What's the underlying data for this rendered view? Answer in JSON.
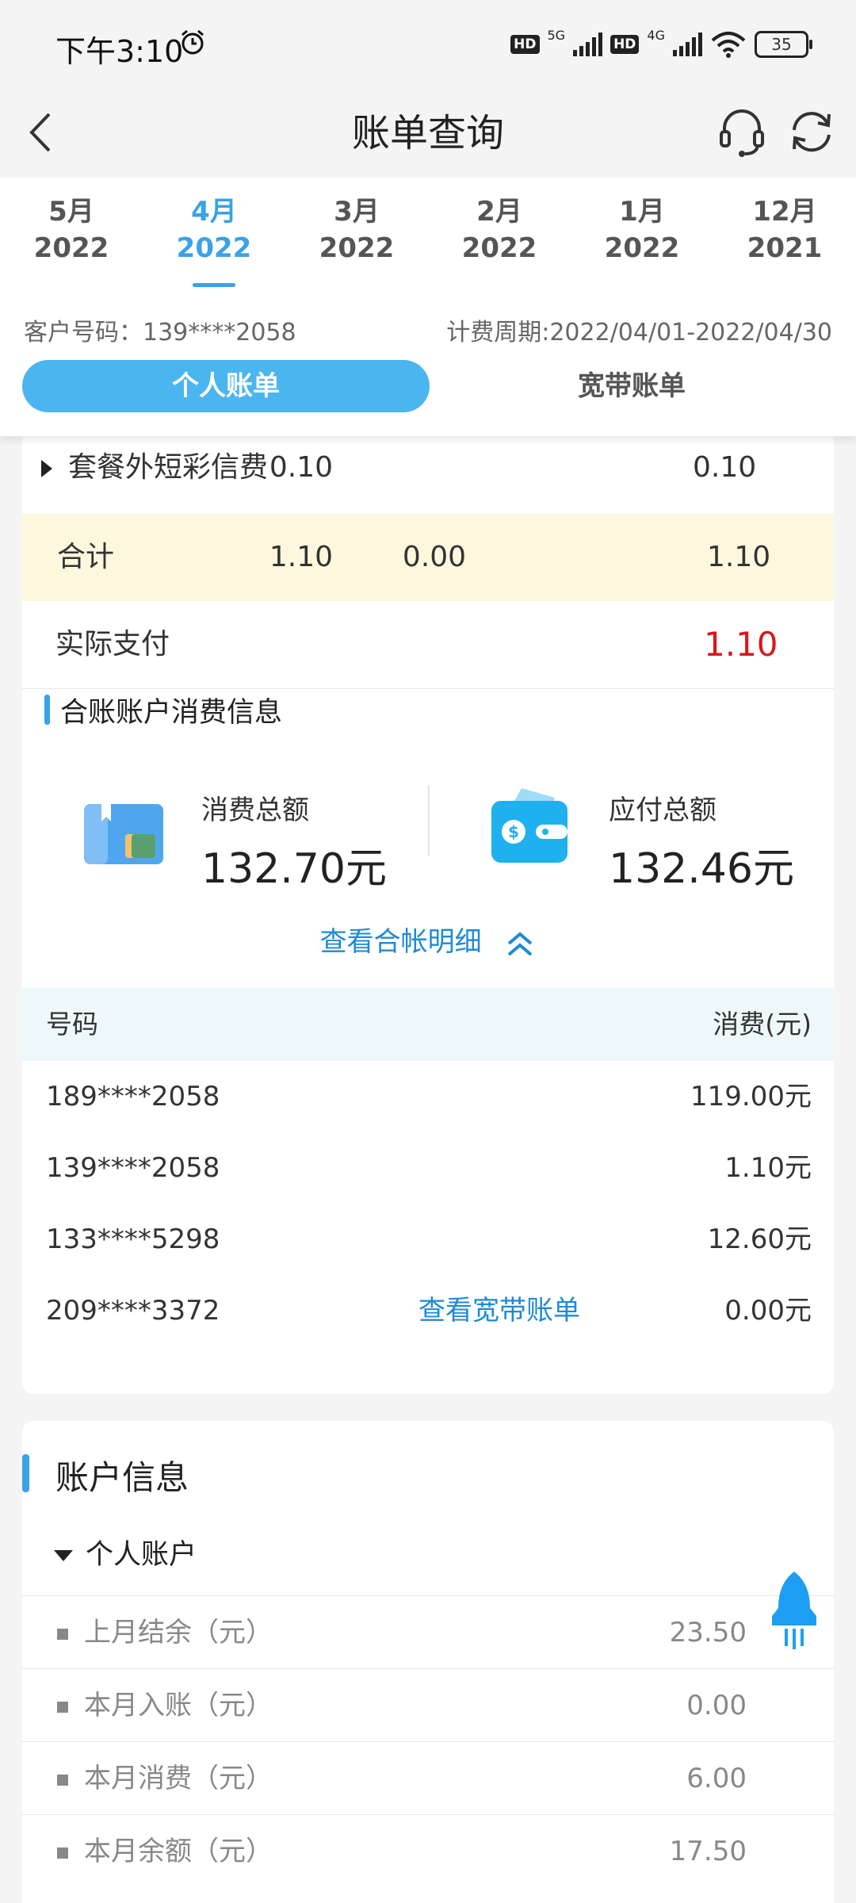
{
  "status_bar": {
    "time": "下午3:10",
    "hd1": "HD",
    "net1": "5G",
    "hd2": "HD",
    "net2": "4G",
    "battery": "35"
  },
  "header": {
    "title": "账单查询",
    "icons": {
      "back": "back-chevron-icon",
      "service": "customer-service-headset-icon",
      "refresh": "refresh-icon"
    }
  },
  "month_tabs": [
    {
      "month": "5月",
      "year": "2022"
    },
    {
      "month": "4月",
      "year": "2022"
    },
    {
      "month": "3月",
      "year": "2022"
    },
    {
      "month": "2月",
      "year": "2022"
    },
    {
      "month": "1月",
      "year": "2022"
    },
    {
      "month": "12月",
      "year": "2021"
    }
  ],
  "active_tab_index": 1,
  "customer": {
    "number_text": "客户号码：139****2058",
    "period_text": "计费周期:2022/04/01-2022/04/30"
  },
  "bill_type": {
    "personal": "个人账单",
    "broadband": "宽带账单"
  },
  "bill_table": {
    "rows": [
      {
        "name": "套餐外短彩信费",
        "col1": "0.10",
        "col2": "",
        "col3": "0.10"
      }
    ],
    "total": {
      "name": "合计",
      "col1": "1.10",
      "col2": "0.00",
      "col3": "1.10"
    },
    "actual": {
      "name": "实际支付",
      "value": "1.10"
    }
  },
  "combined": {
    "title": "合账账户消费信息",
    "consume_label": "消费总额",
    "consume_value": "132.70元",
    "payable_label": "应付总额",
    "payable_value": "132.46元",
    "toggle_label": "查看合帐明细",
    "header_number": "号码",
    "header_amount": "消费(元)",
    "rows": [
      {
        "number": "189****2058",
        "link": "",
        "amount": "119.00元"
      },
      {
        "number": "139****2058",
        "link": "",
        "amount": "1.10元"
      },
      {
        "number": "133****5298",
        "link": "",
        "amount": "12.60元"
      },
      {
        "number": "209****3372",
        "link": "查看宽带账单",
        "amount": "0.00元"
      }
    ]
  },
  "account_info": {
    "title": "账户信息",
    "subtitle": "个人账户",
    "rows": [
      {
        "label": "上月结余（元）",
        "value": "23.50"
      },
      {
        "label": "本月入账（元）",
        "value": "0.00"
      },
      {
        "label": "本月消费（元）",
        "value": "6.00"
      },
      {
        "label": "本月余额（元）",
        "value": "17.50"
      }
    ]
  },
  "colors": {
    "accent": "#3aa2e6",
    "highlight": "#fdf8dd",
    "red": "#d9161c",
    "link": "#1d8ad6"
  }
}
